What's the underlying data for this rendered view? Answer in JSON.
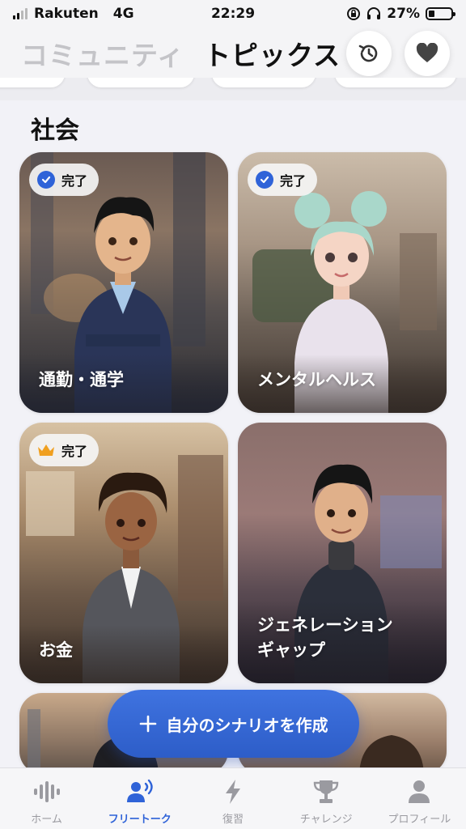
{
  "status_bar": {
    "carrier": "Rakuten",
    "network": "4G",
    "time": "22:29",
    "battery": "27%",
    "battery_level": 0.27
  },
  "header": {
    "tab_inactive": "コミュニティ",
    "tab_active": "トピックス",
    "history_icon": "history-icon",
    "favorite_icon": "heart-icon"
  },
  "section": {
    "title": "社会"
  },
  "cards": [
    {
      "label": "通勤・通学",
      "badge": "完了",
      "badge_icon": "check-icon",
      "accent": "#2f63d8"
    },
    {
      "label": "メンタルヘルス",
      "badge": "完了",
      "badge_icon": "check-icon",
      "accent": "#2f63d8"
    },
    {
      "label": "お金",
      "badge": "完了",
      "badge_icon": "crown-icon",
      "accent": "#f0a020"
    },
    {
      "label": "ジェネレーションギャップ",
      "label_line1": "ジェネレーション",
      "label_line2": "ギャップ"
    }
  ],
  "create_button": {
    "label": "自分のシナリオを作成",
    "icon": "plus-icon"
  },
  "tabbar": {
    "items": [
      {
        "label": "ホーム",
        "icon": "waveform-icon",
        "active": false
      },
      {
        "label": "フリートーク",
        "icon": "speaking-person-icon",
        "active": true
      },
      {
        "label": "復習",
        "icon": "lightning-icon",
        "active": false
      },
      {
        "label": "チャレンジ",
        "icon": "trophy-icon",
        "active": false
      },
      {
        "label": "プロフィール",
        "icon": "person-icon",
        "active": false
      }
    ]
  },
  "colors": {
    "accent": "#2f63d8",
    "background": "#f2f2f7",
    "crown": "#f0a020"
  }
}
